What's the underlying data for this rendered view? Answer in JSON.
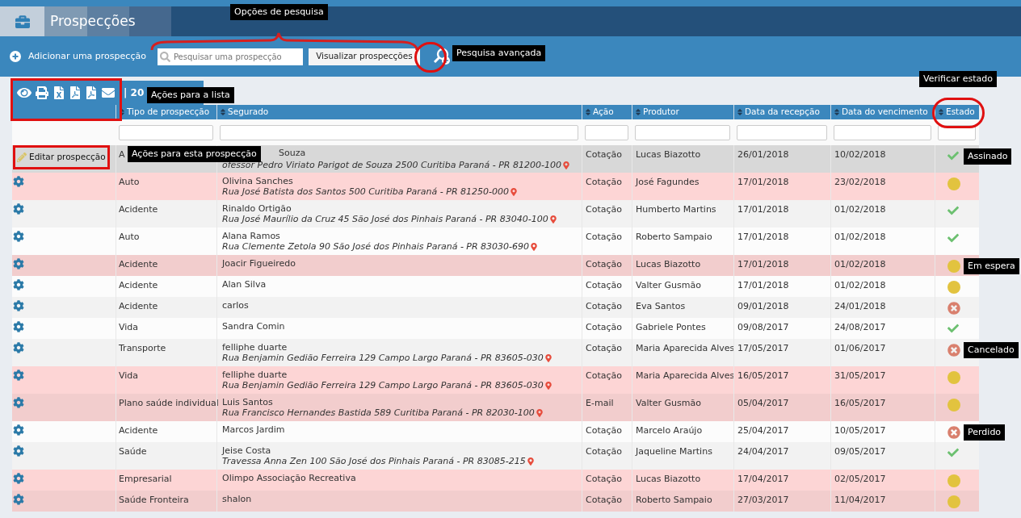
{
  "header": {
    "title": "Prospecções"
  },
  "toolbar": {
    "add_label": "Adicionar uma prospecção",
    "search": {
      "placeholder": "Pesquisar uma prospecção"
    },
    "view_button": "Visualizar prospecções"
  },
  "annotations": {
    "search_options": "Opções de pesquisa",
    "advanced_search": "Pesquisa avançada",
    "list_actions": "Ações para a lista",
    "row_actions": "Ações para esta prospecção",
    "check_status": "Verificar estado"
  },
  "list_actions": {
    "count": "| 20"
  },
  "table": {
    "columns": [
      "Tipo de prospecção",
      "Segurado",
      "Ação",
      "Produtor",
      "Data da recepção",
      "Data do vencimento",
      "Estado"
    ],
    "rows": [
      {
        "color": "#d8d8d8",
        "action_label": "Editar prospecção",
        "type": "A",
        "name": "Souza",
        "address": "ofessor Pedro Viriato Parigot de Souza 2500 Curitiba Paraná - PR 81200-100",
        "action": "Cotação",
        "producer": "Lucas Biazotto",
        "received": "26/01/2018",
        "due": "10/02/2018",
        "status": {
          "kind": "signed"
        },
        "tooltip": "Assinado"
      },
      {
        "color": "#fdd5d5",
        "type": "Auto",
        "name": "Olivina Sanches",
        "address": "Rua José Batista dos Santos 500 Curitiba Paraná - PR 81250-000",
        "action": "Cotação",
        "producer": "José Fagundes",
        "received": "17/01/2018",
        "due": "23/02/2018",
        "status": {
          "kind": "waiting"
        }
      },
      {
        "color": "#f2f2f2",
        "type": "Acidente",
        "name": "Rinaldo Ortigão",
        "address": "Rua José Maurílio da Cruz 45 São José dos Pinhais Paraná - PR 83040-100",
        "action": "Cotação",
        "producer": "Humberto Martins",
        "received": "17/01/2018",
        "due": "01/02/2018",
        "status": {
          "kind": "signed"
        }
      },
      {
        "color": "#fcfcfc",
        "type": "Auto",
        "name": "Alana Ramos",
        "address": "Rua Clemente Zetola 90 São José dos Pinhais Paraná - PR 83030-690",
        "action": "Cotação",
        "producer": "Roberto Sampaio",
        "received": "17/01/2018",
        "due": "01/02/2018",
        "status": {
          "kind": "signed"
        }
      },
      {
        "color": "#f2cdcd",
        "type": "Acidente",
        "name": "Joacir Figueiredo",
        "action": "Cotação",
        "producer": "Lucas Biazotto",
        "received": "17/01/2018",
        "due": "01/02/2018",
        "status": {
          "kind": "waiting"
        },
        "tooltip": "Em espera"
      },
      {
        "color": "#fcfcfc",
        "type": "Acidente",
        "name": "Alan Silva",
        "action": "Cotação",
        "producer": "Valter Gusmão",
        "received": "17/01/2018",
        "due": "01/02/2018",
        "status": {
          "kind": "waiting"
        }
      },
      {
        "color": "#f2f2f2",
        "type": "Acidente",
        "name": "carlos",
        "action": "Cotação",
        "producer": "Eva Santos",
        "received": "09/01/2018",
        "due": "24/01/2018",
        "status": {
          "kind": "cancelled"
        }
      },
      {
        "color": "#fcfcfc",
        "type": "Vida",
        "name": "Sandra Comin",
        "action": "Cotação",
        "producer": "Gabriele Pontes",
        "received": "09/08/2017",
        "due": "24/08/2017",
        "status": {
          "kind": "signed"
        }
      },
      {
        "color": "#f2f2f2",
        "type": "Transporte",
        "name": "felliphe duarte",
        "address": "Rua Benjamin Gedião Ferreira 129 Campo Largo Paraná - PR 83605-030",
        "action": "Cotação",
        "producer": "Maria Aparecida Alves",
        "received": "17/05/2017",
        "due": "01/06/2017",
        "status": {
          "kind": "cancelled"
        },
        "tooltip": "Cancelado"
      },
      {
        "color": "#fdd5d5",
        "type": "Vida",
        "name": "felliphe duarte",
        "address": "Rua Benjamin Gedião Ferreira 129 Campo Largo Paraná - PR 83605-030",
        "action": "Cotação",
        "producer": "Maria Aparecida Alves",
        "received": "16/05/2017",
        "due": "31/05/2017",
        "status": {
          "kind": "waiting"
        }
      },
      {
        "color": "#f2cdcd",
        "type": "Plano saúde individual",
        "name": "Luis Santos",
        "address": "Rua Francisco Hernandes Bastida 589 Curitiba Paraná - PR 82030-100",
        "action": "E-mail",
        "producer": "Valter Gusmão",
        "received": "05/04/2017",
        "due": "16/05/2017",
        "status": {
          "kind": "waiting"
        }
      },
      {
        "color": "#fcfcfc",
        "type": "Acidente",
        "name": "Marcos Jardim",
        "action": "Cotação",
        "producer": "Marcelo Araújo",
        "received": "25/04/2017",
        "due": "10/05/2017",
        "status": {
          "kind": "cancelled"
        },
        "tooltip": "Perdido"
      },
      {
        "color": "#f2f2f2",
        "type": "Saúde",
        "name": "Jeise Costa",
        "address": "Travessa Anna Zen 100 São José dos Pinhais Paraná - PR 83085-215",
        "action": "Cotação",
        "producer": "Jaqueline Martins",
        "received": "24/04/2017",
        "due": "09/05/2017",
        "status": {
          "kind": "signed"
        }
      },
      {
        "color": "#fdd5d5",
        "type": "Empresarial",
        "name": "Olimpo Associação Recreativa",
        "action": "Cotação",
        "producer": "Lucas Biazotto",
        "received": "17/04/2017",
        "due": "02/05/2017",
        "status": {
          "kind": "waiting"
        }
      },
      {
        "color": "#f2cdcd",
        "type": "Saúde Fronteira",
        "name": "shalon",
        "action": "Cotação",
        "producer": "Roberto Sampaio",
        "received": "27/03/2017",
        "due": "11/04/2017",
        "status": {
          "kind": "waiting"
        }
      }
    ]
  }
}
